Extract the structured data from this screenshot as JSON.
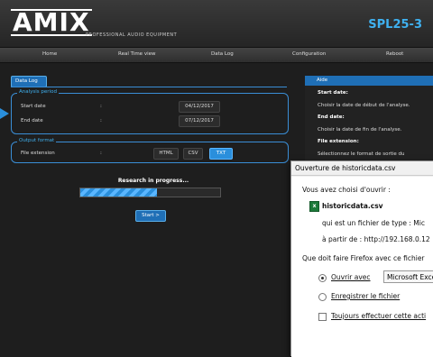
{
  "header": {
    "logo": "AMIX",
    "tagline": "PROFESSIONAL AUDIO EQUIPMENT",
    "product": "SPL25-3"
  },
  "nav": [
    "Home",
    "Real Time view",
    "Data Log",
    "Configuration",
    "Reboot"
  ],
  "datalog": {
    "tab": "Data Log",
    "analysis": {
      "legend": "Analysis period",
      "start_label": "Start date",
      "end_label": "End date",
      "colon": ":",
      "start_value": "04/12/2017",
      "end_value": "07/12/2017"
    },
    "output": {
      "legend": "Output format",
      "ext_label": "File extension",
      "colon": ":",
      "formats": [
        "HTML",
        "CSV",
        "TXT"
      ],
      "selected": "TXT"
    },
    "progress": {
      "title": "Research in progress...",
      "fraction": 0.55
    },
    "start_button": "Start >"
  },
  "aide": {
    "title": "Aide",
    "lines": [
      {
        "text": "Start date:",
        "bold": true
      },
      {
        "text": "Choisir la date de début de l'analyse.",
        "bold": false
      },
      {
        "text": "End date:",
        "bold": true
      },
      {
        "text": "Choisir la date de fin de l'analyse.",
        "bold": false
      },
      {
        "text": "File extension:",
        "bold": true
      },
      {
        "text": "Sélectionnez le format de sortie du",
        "bold": false
      }
    ]
  },
  "dialog": {
    "title": "Ouverture de historicdata.csv",
    "intro": "Vous avez choisi d'ouvrir :",
    "filename": "historicdata.csv",
    "type_line": "qui est un fichier de type : Mic",
    "from_line": "à partir de : http://192.168.0.12",
    "question": "Que doit faire Firefox avec ce fichier",
    "open_with": "Ouvrir avec",
    "app": "Microsoft Exce",
    "save": "Enregistrer le fichier",
    "always": "Toujours effectuer cette acti"
  },
  "colors": {
    "accent": "#2a8fdc",
    "product": "#3fb1f0",
    "background": "#1e1e1e"
  }
}
